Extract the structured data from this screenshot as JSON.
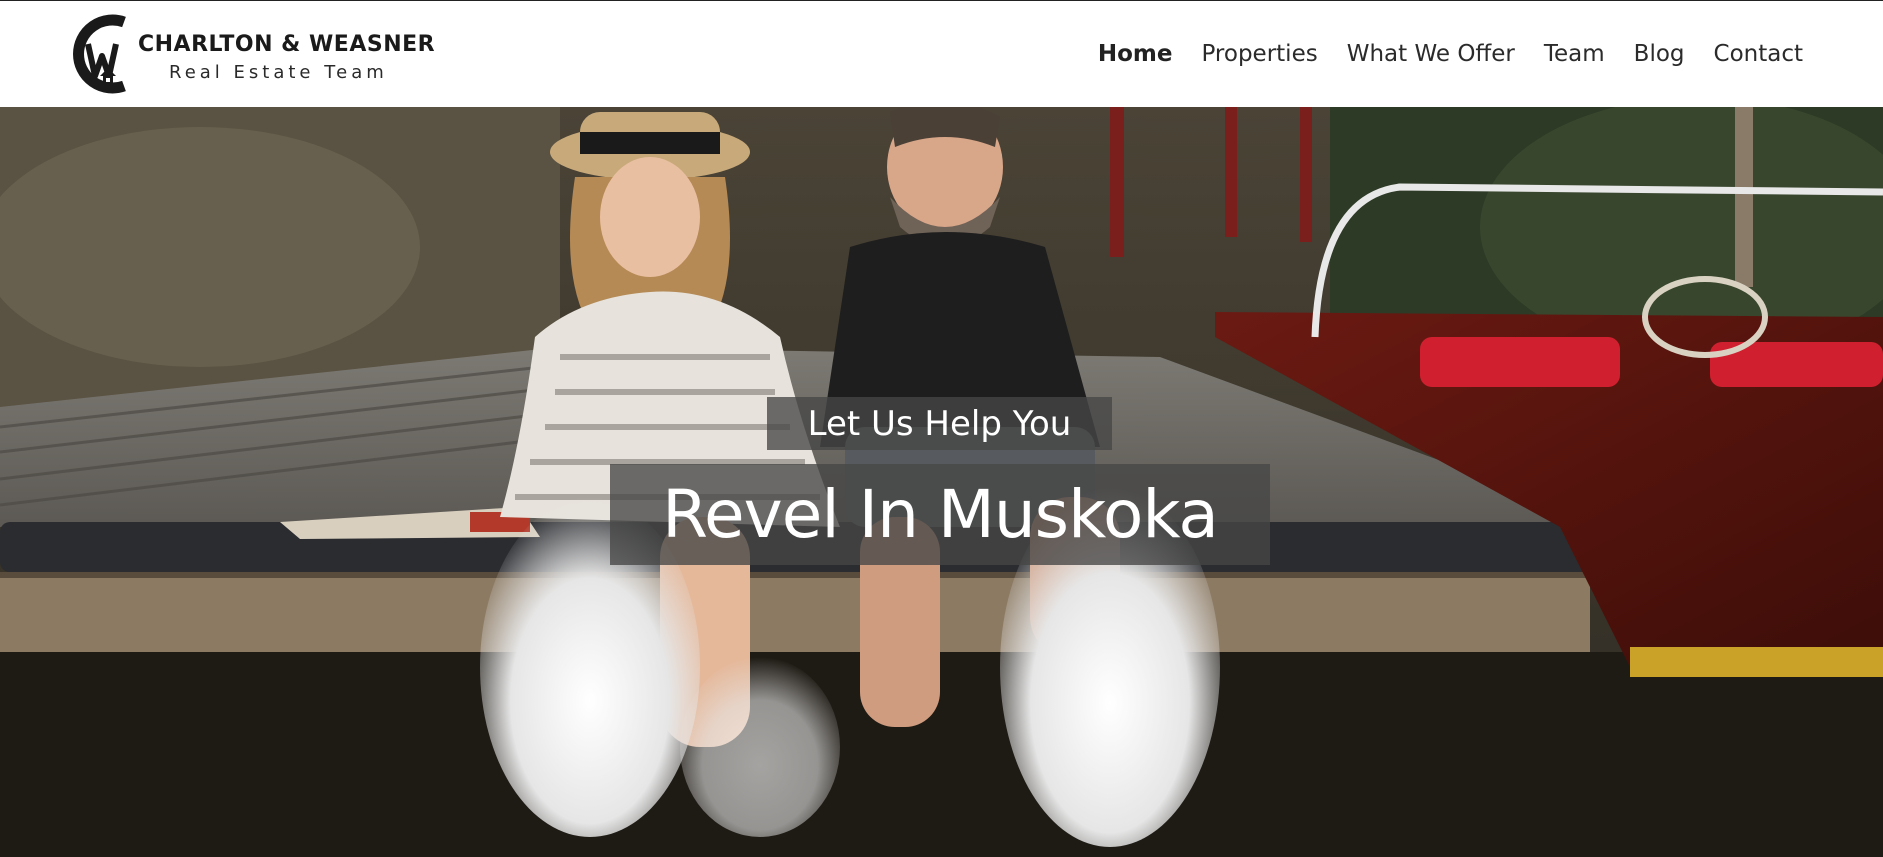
{
  "brand": {
    "line1": "CHARLTON & WEASNER",
    "line2": "Real Estate Team",
    "logo_icon": "cw-house-logo-icon"
  },
  "nav": {
    "items": [
      {
        "label": "Home",
        "active": true
      },
      {
        "label": "Properties",
        "active": false
      },
      {
        "label": "What We Offer",
        "active": false
      },
      {
        "label": "Team",
        "active": false
      },
      {
        "label": "Blog",
        "active": false
      },
      {
        "label": "Contact",
        "active": false
      }
    ]
  },
  "hero": {
    "subheading": "Let Us Help You",
    "heading": "Revel In Muskoka",
    "image": "couple-on-dock-splashing-water-photo"
  }
}
